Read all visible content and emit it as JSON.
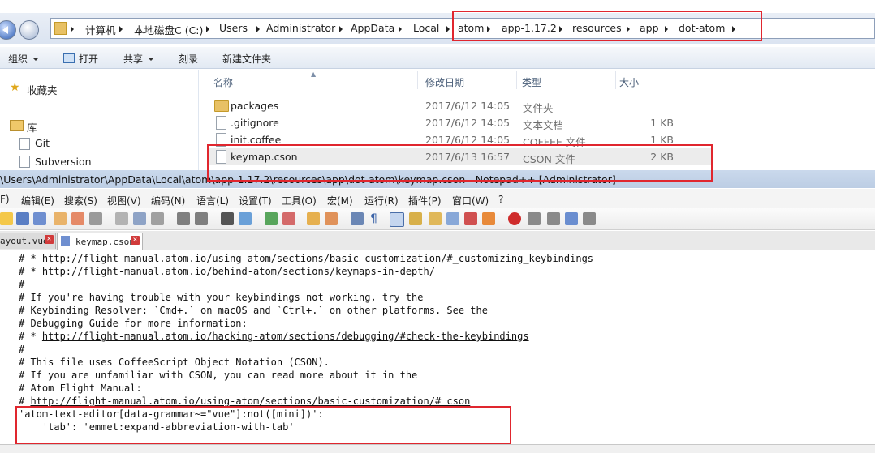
{
  "explorer": {
    "breadcrumbs": [
      "计算机",
      "本地磁盘C (C:)",
      "Users",
      "Administrator",
      "AppData",
      "Local",
      "atom",
      "app-1.17.2",
      "resources",
      "app",
      "dot-atom"
    ],
    "toolbar": {
      "organize": "组织",
      "open": "打开",
      "share": "共享",
      "burn": "刻录",
      "new_folder": "新建文件夹"
    },
    "nav": {
      "favorites": "收藏夹",
      "library": "库",
      "git": "Git",
      "subversion": "Subversion"
    },
    "columns": {
      "name": "名称",
      "date": "修改日期",
      "type": "类型",
      "size": "大小"
    },
    "files": [
      {
        "name": "packages",
        "date": "2017/6/12 14:05",
        "type": "文件夹",
        "size": "",
        "icon": "folder-icon"
      },
      {
        "name": ".gitignore",
        "date": "2017/6/12 14:05",
        "type": "文本文档",
        "size": "1 KB",
        "icon": "text-file-icon"
      },
      {
        "name": "init.coffee",
        "date": "2017/6/12 14:05",
        "type": "COFFEE 文件",
        "size": "1 KB",
        "icon": "file-icon"
      },
      {
        "name": "keymap.cson",
        "date": "2017/6/13 16:57",
        "type": "CSON 文件",
        "size": "2 KB",
        "icon": "file-icon"
      }
    ]
  },
  "notepad": {
    "title": "\\Users\\Administrator\\AppData\\Local\\atom\\app-1.17.2\\resources\\app\\dot-atom\\keymap.cson - Notepad++ [Administrator]",
    "menu": [
      "F)",
      "编辑(E)",
      "搜索(S)",
      "视图(V)",
      "编码(N)",
      "语言(L)",
      "设置(T)",
      "工具(O)",
      "宏(M)",
      "运行(R)",
      "插件(P)",
      "窗口(W)",
      "?"
    ],
    "tabs": [
      {
        "label": "ayout.vue"
      },
      {
        "label": "keymap.cson"
      }
    ],
    "code_lines": [
      {
        "prefix": "# * ",
        "link": "http://flight-manual.atom.io/using-atom/sections/basic-customization/#_customizing_keybindings",
        "suffix": ""
      },
      {
        "prefix": "# * ",
        "link": "http://flight-manual.atom.io/behind-atom/sections/keymaps-in-depth/",
        "suffix": ""
      },
      {
        "prefix": "#",
        "link": "",
        "suffix": ""
      },
      {
        "prefix": "# If you're having trouble with your keybindings not working, try the",
        "link": "",
        "suffix": ""
      },
      {
        "prefix": "# Keybinding Resolver: `Cmd+.` on macOS and `Ctrl+.` on other platforms. See the",
        "link": "",
        "suffix": ""
      },
      {
        "prefix": "# Debugging Guide for more information:",
        "link": "",
        "suffix": ""
      },
      {
        "prefix": "# * ",
        "link": "http://flight-manual.atom.io/hacking-atom/sections/debugging/#check-the-keybindings",
        "suffix": ""
      },
      {
        "prefix": "#",
        "link": "",
        "suffix": ""
      },
      {
        "prefix": "# This file uses CoffeeScript Object Notation (CSON).",
        "link": "",
        "suffix": ""
      },
      {
        "prefix": "# If you are unfamiliar with CSON, you can read more about it in the",
        "link": "",
        "suffix": ""
      },
      {
        "prefix": "# Atom Flight Manual:",
        "link": "",
        "suffix": ""
      },
      {
        "prefix": "# ",
        "link": "http://flight-manual.atom.io/using-atom/sections/basic-customization/#_cson",
        "suffix": ""
      },
      {
        "prefix": "'atom-text-editor[data-grammar~=\"vue\"]:not([mini])':",
        "link": "",
        "suffix": ""
      },
      {
        "prefix": "    'tab': 'emmet:expand-abbreviation-with-tab'",
        "link": "",
        "suffix": ""
      }
    ]
  },
  "colors": {
    "highlight": "#e0262e",
    "title_bar": "#bccde4",
    "address_bg": "#dbe4f1"
  }
}
